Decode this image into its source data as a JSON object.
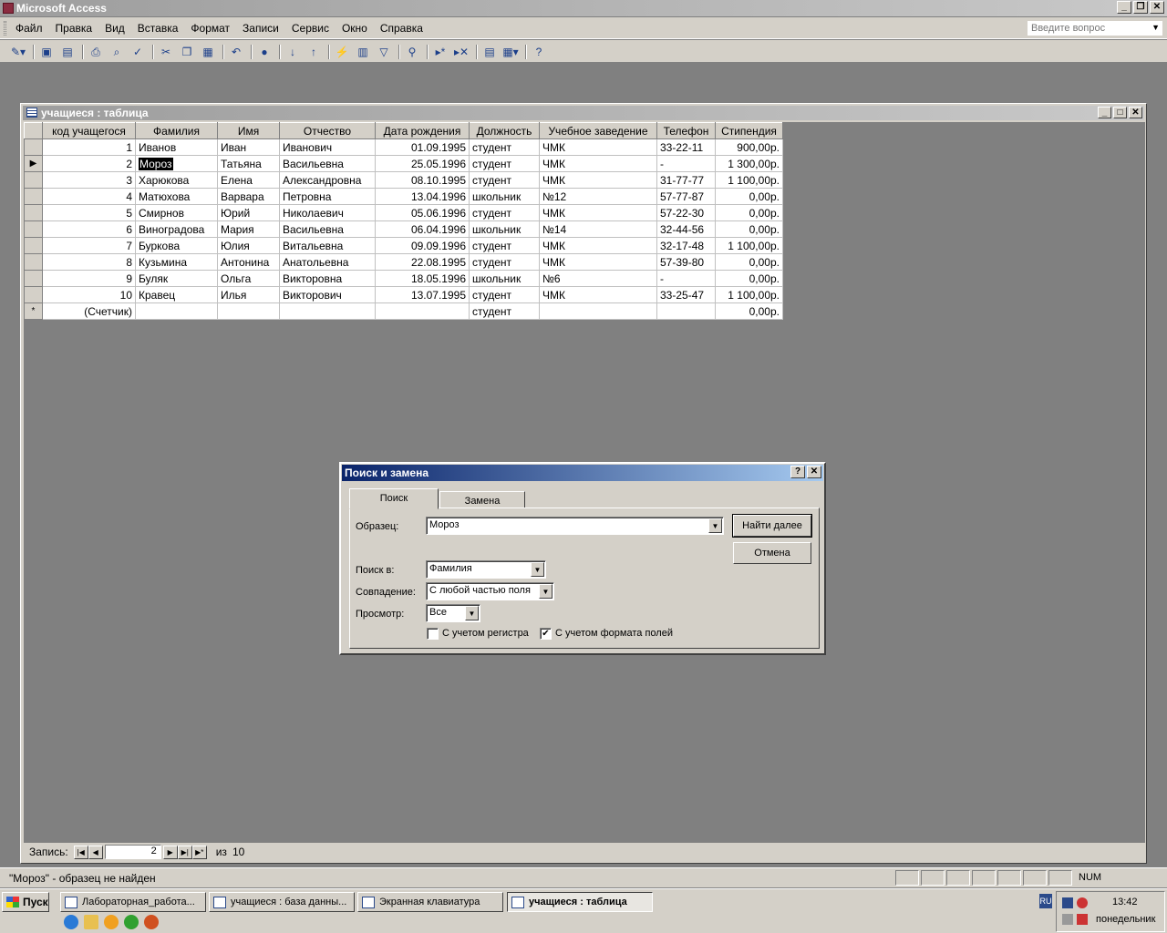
{
  "app": {
    "title": "Microsoft Access"
  },
  "menu": [
    "Файл",
    "Правка",
    "Вид",
    "Вставка",
    "Формат",
    "Записи",
    "Сервис",
    "Окно",
    "Справка"
  ],
  "ask_placeholder": "Введите вопрос",
  "child_window": {
    "title": "учащиеся : таблица"
  },
  "table": {
    "columns": [
      "код учащегося",
      "Фамилия",
      "Имя",
      "Отчество",
      "Дата рождения",
      "Должность",
      "Учебное заведение",
      "Телефон",
      "Стипендия"
    ],
    "rows": [
      [
        "1",
        "Иванов",
        "Иван",
        "Иванович",
        "01.09.1995",
        "студент",
        "ЧМК",
        "33-22-11",
        "900,00р."
      ],
      [
        "2",
        "Мороз",
        "Татьяна",
        "Васильевна",
        "25.05.1996",
        "студент",
        "ЧМК",
        "-",
        "1 300,00р."
      ],
      [
        "3",
        "Харюкова",
        "Елена",
        "Александровна",
        "08.10.1995",
        "студент",
        "ЧМК",
        "31-77-77",
        "1 100,00р."
      ],
      [
        "4",
        "Матюхова",
        "Варвара",
        "Петровна",
        "13.04.1996",
        "школьник",
        "№12",
        "57-77-87",
        "0,00р."
      ],
      [
        "5",
        "Смирнов",
        "Юрий",
        "Николаевич",
        "05.06.1996",
        "студент",
        "ЧМК",
        "57-22-30",
        "0,00р."
      ],
      [
        "6",
        "Виноградова",
        "Мария",
        "Васильевна",
        "06.04.1996",
        "школьник",
        "№14",
        "32-44-56",
        "0,00р."
      ],
      [
        "7",
        "Буркова",
        "Юлия",
        "Витальевна",
        "09.09.1996",
        "студент",
        "ЧМК",
        "32-17-48",
        "1 100,00р."
      ],
      [
        "8",
        "Кузьмина",
        "Антонина",
        "Анатольевна",
        "22.08.1995",
        "студент",
        "ЧМК",
        "57-39-80",
        "0,00р."
      ],
      [
        "9",
        "Буляк",
        "Ольга",
        "Викторовна",
        "18.05.1996",
        "школьник",
        "№6",
        "-",
        "0,00р."
      ],
      [
        "10",
        "Кравец",
        "Илья",
        "Викторович",
        "13.07.1995",
        "студент",
        "ЧМК",
        "33-25-47",
        "1 100,00р."
      ]
    ],
    "new_row": [
      "(Счетчик)",
      "",
      "",
      "",
      "",
      "студент",
      "",
      "",
      "0,00р."
    ],
    "current_row_index": 1
  },
  "nav": {
    "label": "Запись:",
    "current": "2",
    "of_label": "из",
    "total": "10"
  },
  "dialog": {
    "title": "Поиск и замена",
    "tabs": [
      "Поиск",
      "Замена"
    ],
    "labels": {
      "sample": "Образец:",
      "search_in": "Поиск в:",
      "match": "Совпадение:",
      "view": "Просмотр:"
    },
    "values": {
      "sample": "Мороз",
      "search_in": "Фамилия",
      "match": "С любой частью поля",
      "view": "Все"
    },
    "buttons": {
      "find_next": "Найти далее",
      "cancel": "Отмена"
    },
    "checks": {
      "case_label": "С учетом регистра",
      "case_checked": false,
      "format_label": "С учетом формата полей",
      "format_checked": true
    }
  },
  "status": {
    "message": "\"Мороз\" - образец не найден",
    "num": "NUM"
  },
  "taskbar": {
    "start": "Пуск",
    "tasks": [
      "Лабораторная_работа...",
      "учащиеся : база данны...",
      "Экранная клавиатура",
      "учащиеся : таблица"
    ],
    "lang": "RU",
    "time": "13:42",
    "day": "понедельник"
  }
}
